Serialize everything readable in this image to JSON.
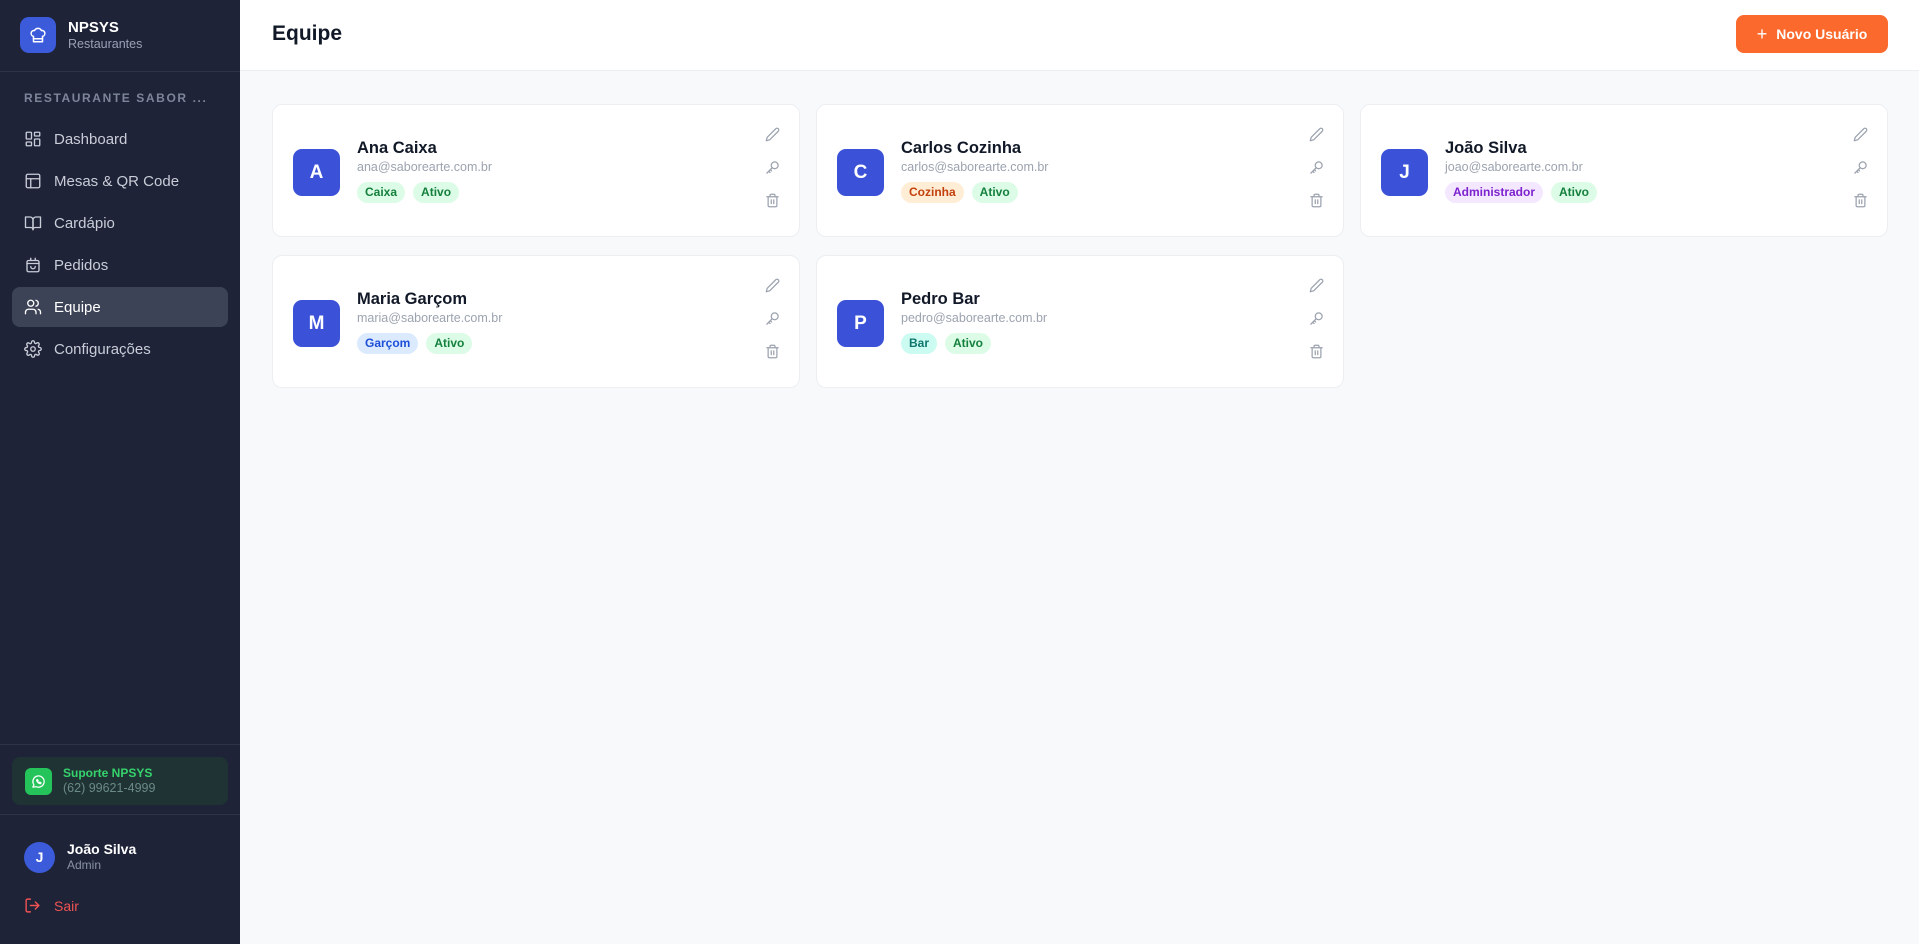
{
  "brand": {
    "name": "NPSYS",
    "subtitle": "Restaurantes"
  },
  "sidebar": {
    "section_label": "RESTAURANTE SABOR ...",
    "items": [
      {
        "label": "Dashboard",
        "icon": "dashboard-icon"
      },
      {
        "label": "Mesas & QR Code",
        "icon": "table-grid-icon"
      },
      {
        "label": "Cardápio",
        "icon": "book-open-icon"
      },
      {
        "label": "Pedidos",
        "icon": "shopping-bag-icon"
      },
      {
        "label": "Equipe",
        "icon": "users-icon",
        "active": true
      },
      {
        "label": "Configurações",
        "icon": "gear-icon"
      }
    ],
    "support": {
      "title": "Suporte NPSYS",
      "phone": "(62) 99621-4999",
      "icon": "whatsapp-icon"
    },
    "user": {
      "initial": "J",
      "name": "João Silva",
      "role": "Admin"
    },
    "logout_label": "Sair"
  },
  "header": {
    "title": "Equipe",
    "new_user_label": "Novo Usuário"
  },
  "team": [
    {
      "initial": "A",
      "name": "Ana Caixa",
      "email": "ana@saborearte.com.br",
      "role": "Caixa",
      "status": "Ativo"
    },
    {
      "initial": "C",
      "name": "Carlos Cozinha",
      "email": "carlos@saborearte.com.br",
      "role": "Cozinha",
      "status": "Ativo"
    },
    {
      "initial": "J",
      "name": "João Silva",
      "email": "joao@saborearte.com.br",
      "role": "Administrador",
      "status": "Ativo"
    },
    {
      "initial": "M",
      "name": "Maria Garçom",
      "email": "maria@saborearte.com.br",
      "role": "Garçom",
      "status": "Ativo"
    },
    {
      "initial": "P",
      "name": "Pedro Bar",
      "email": "pedro@saborearte.com.br",
      "role": "Bar",
      "status": "Ativo"
    }
  ],
  "colors": {
    "sidebar_bg": "#1e2338",
    "accent": "#3b52d8",
    "primary_button": "#fb6a2c",
    "status_active_bg": "#dcfce7",
    "status_active_text": "#15803d"
  }
}
